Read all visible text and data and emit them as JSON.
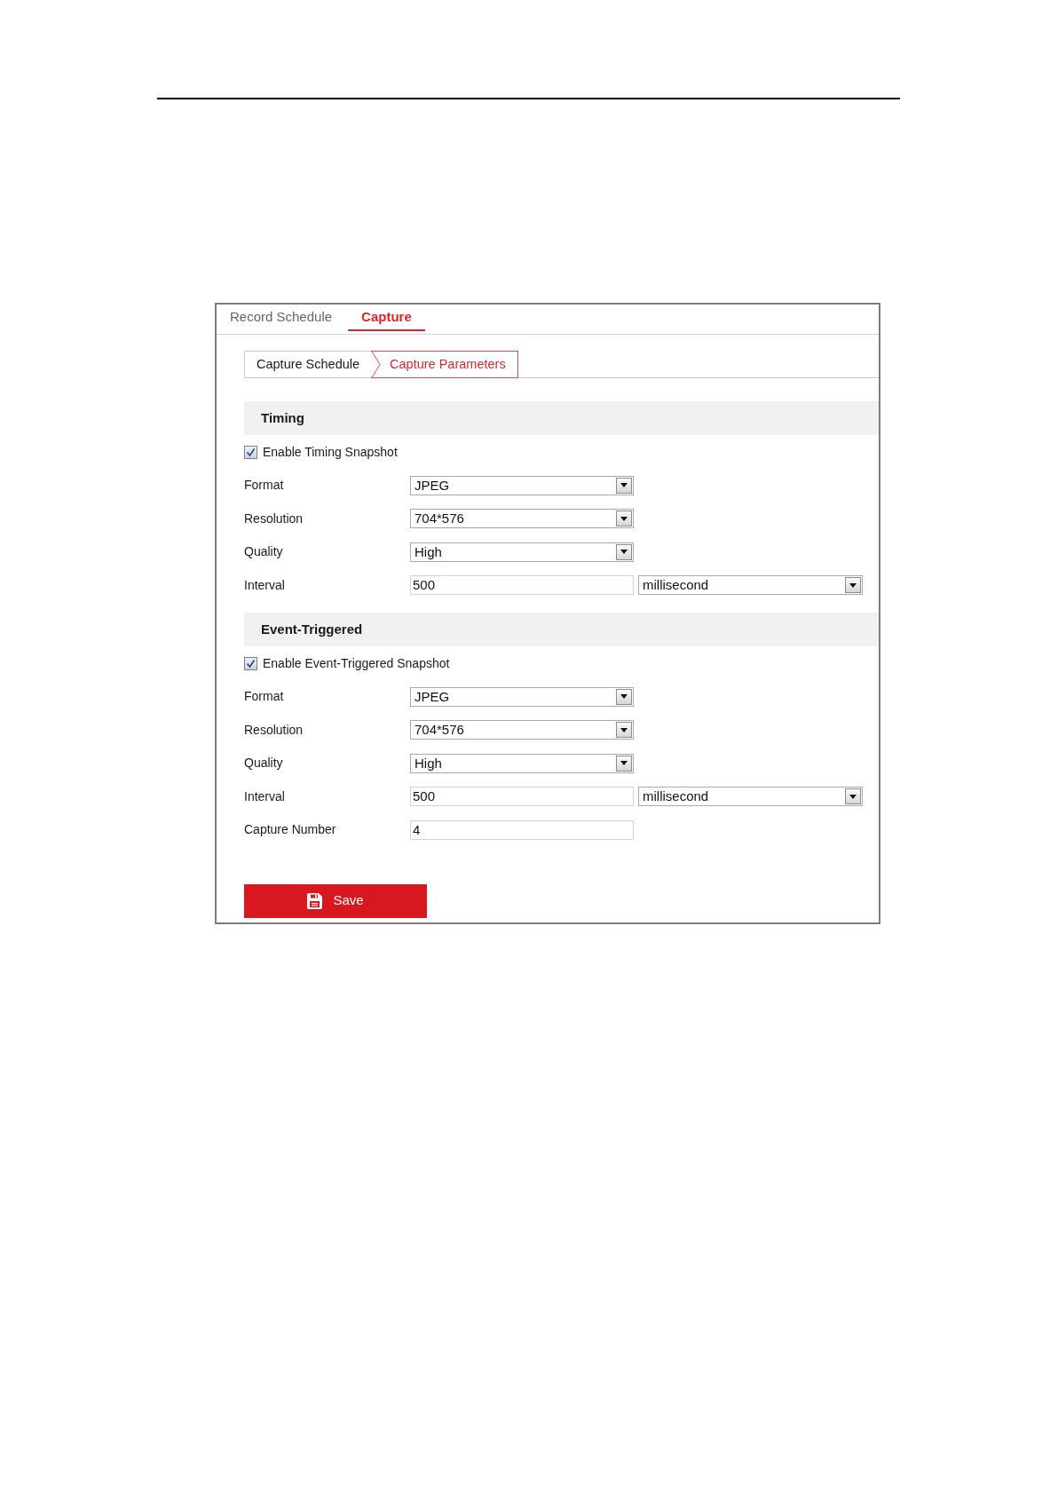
{
  "tabs": [
    {
      "label": "Record Schedule",
      "selected": false
    },
    {
      "label": "Capture",
      "selected": true
    }
  ],
  "sub_tabs": [
    {
      "label": "Capture Schedule",
      "selected": false
    },
    {
      "label": "Capture Parameters",
      "selected": true
    }
  ],
  "sections": [
    {
      "title": "Timing",
      "enable": {
        "label": "Enable Timing Snapshot",
        "checked": true
      },
      "fields": [
        {
          "kind": "select",
          "label": "Format",
          "value": "JPEG"
        },
        {
          "kind": "select",
          "label": "Resolution",
          "value": "704*576"
        },
        {
          "kind": "select",
          "label": "Quality",
          "value": "High"
        },
        {
          "kind": "input_unit",
          "label": "Interval",
          "value": "500",
          "unit": "millisecond"
        }
      ]
    },
    {
      "title": "Event-Triggered",
      "enable": {
        "label": "Enable Event-Triggered Snapshot",
        "checked": true
      },
      "fields": [
        {
          "kind": "select",
          "label": "Format",
          "value": "JPEG"
        },
        {
          "kind": "select",
          "label": "Resolution",
          "value": "704*576"
        },
        {
          "kind": "select",
          "label": "Quality",
          "value": "High"
        },
        {
          "kind": "input_unit",
          "label": "Interval",
          "value": "500",
          "unit": "millisecond"
        },
        {
          "kind": "input",
          "label": "Capture Number",
          "value": "4"
        }
      ]
    }
  ],
  "save_button": {
    "label": "Save"
  }
}
